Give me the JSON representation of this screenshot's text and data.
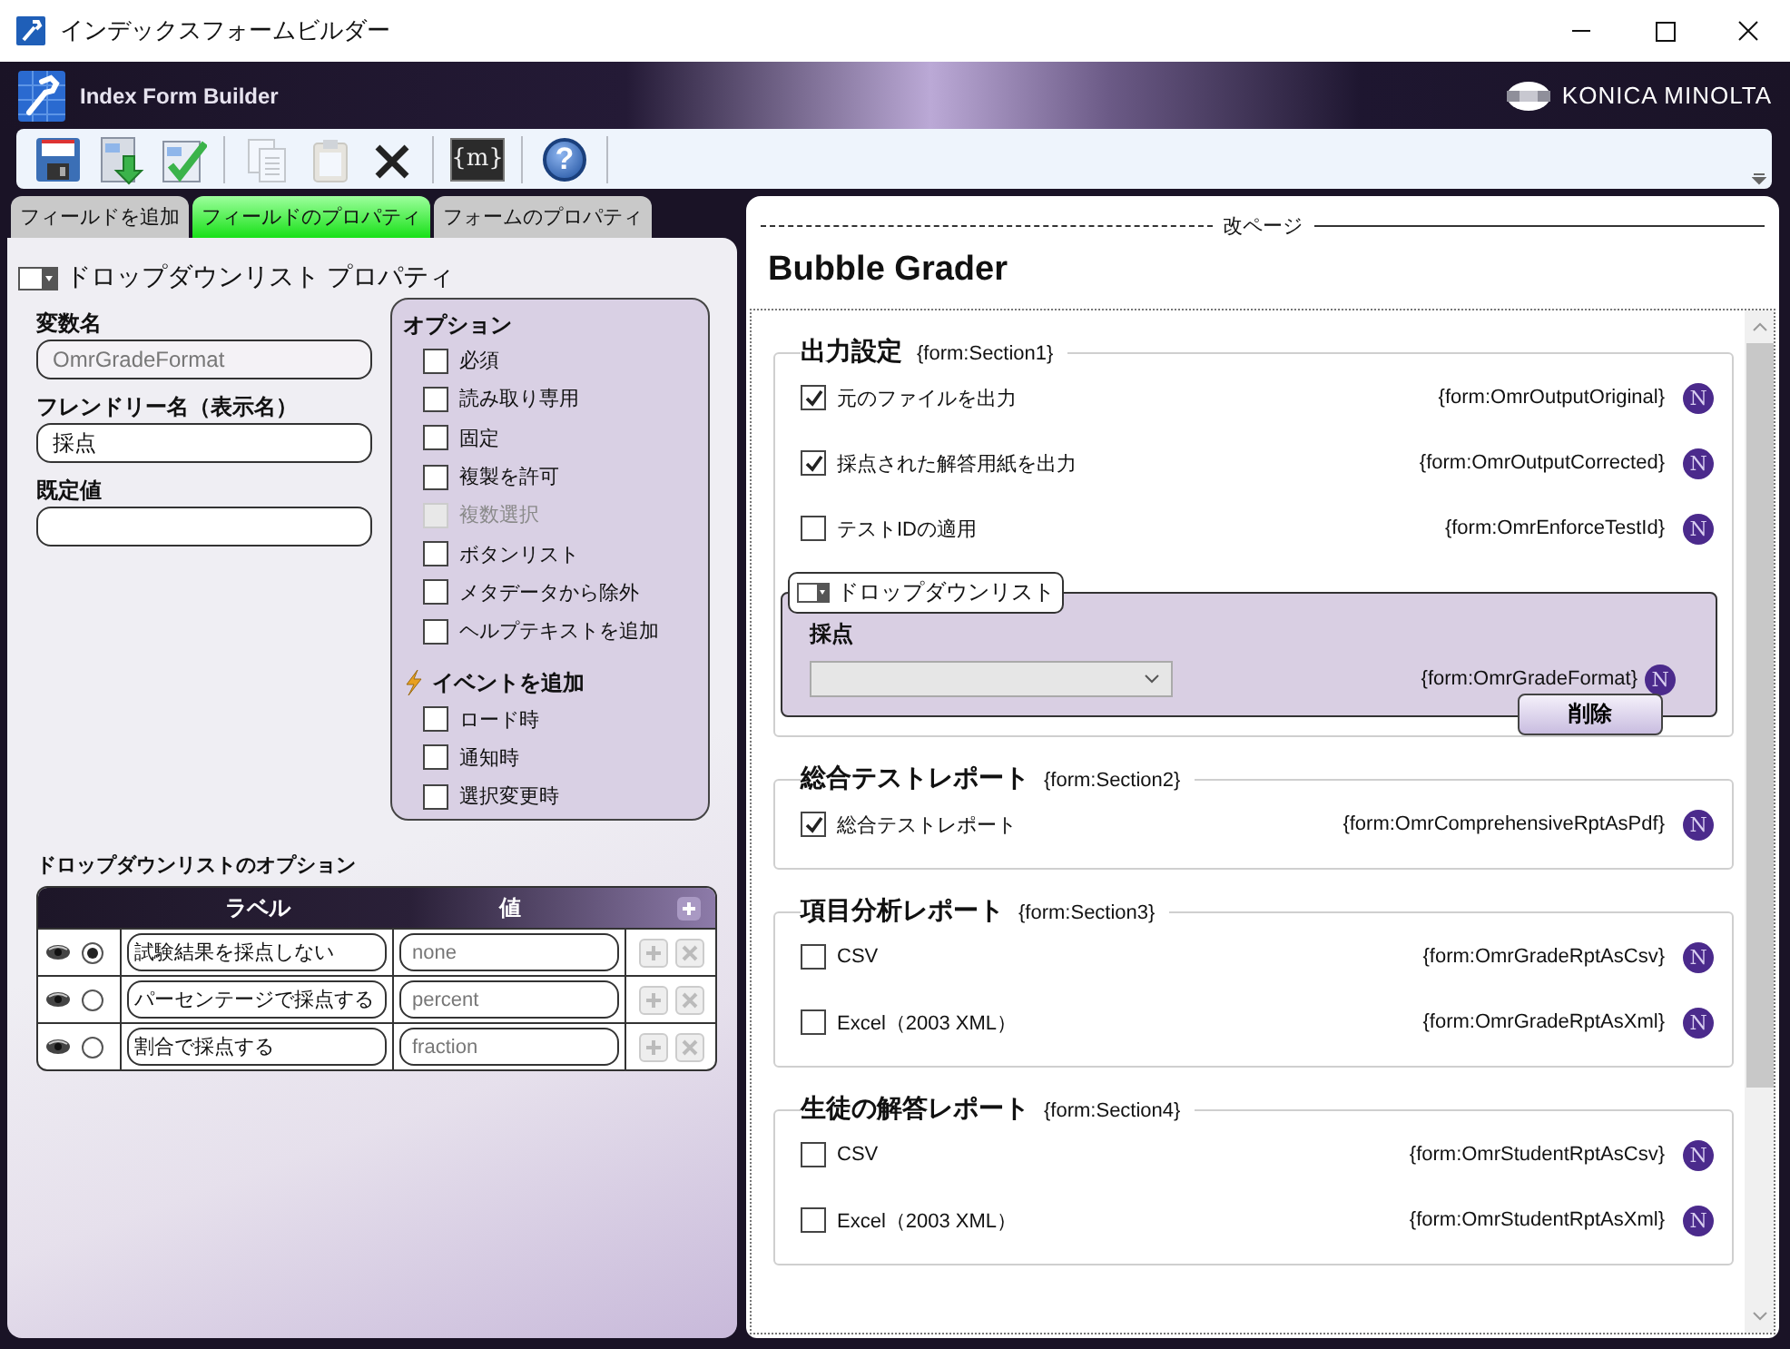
{
  "window": {
    "title": "インデックスフォームビルダー"
  },
  "header": {
    "app_name": "Index Form Builder",
    "brand": "KONICA MINOLTA"
  },
  "toolbar": [
    {
      "kind": "save",
      "disabled": false
    },
    {
      "kind": "import",
      "disabled": false
    },
    {
      "kind": "validate",
      "disabled": false
    },
    {
      "kind": "separator"
    },
    {
      "kind": "copy",
      "disabled": true
    },
    {
      "kind": "paste",
      "disabled": true
    },
    {
      "kind": "delete",
      "disabled": false
    },
    {
      "kind": "separator"
    },
    {
      "kind": "variable",
      "label": "{m}",
      "disabled": false
    },
    {
      "kind": "separator"
    },
    {
      "kind": "help",
      "label": "?",
      "disabled": false
    },
    {
      "kind": "separator"
    }
  ],
  "tabs": [
    {
      "label": "フィールドを追加",
      "selected": false
    },
    {
      "label": "フィールドのプロパティ",
      "selected": true
    },
    {
      "label": "フォームのプロパティ",
      "selected": false
    }
  ],
  "properties": {
    "title": "ドロップダウンリスト プロパティ",
    "fields": [
      {
        "label": "変数名",
        "value": "OmrGradeFormat",
        "disabled": true
      },
      {
        "label": "フレンドリー名（表示名）",
        "value": "採点",
        "disabled": false
      },
      {
        "label": "既定値",
        "disabled": false
      }
    ],
    "options": {
      "title": "オプション",
      "items": [
        {
          "label": "必須",
          "checked": false,
          "disabled": false
        },
        {
          "label": "読み取り専用",
          "checked": false,
          "disabled": false
        },
        {
          "label": "固定",
          "checked": false,
          "disabled": false
        },
        {
          "label": "複製を許可",
          "checked": false,
          "disabled": false
        },
        {
          "label": "複数選択",
          "checked": false,
          "disabled": true
        },
        {
          "label": "ボタンリスト",
          "checked": false,
          "disabled": false
        },
        {
          "label": "メタデータから除外",
          "checked": false,
          "disabled": false
        },
        {
          "label": "ヘルプテキストを追加",
          "checked": false,
          "disabled": false
        }
      ]
    },
    "events": {
      "title": "イベントを追加",
      "items": [
        {
          "label": "ロード時",
          "checked": false
        },
        {
          "label": "通知時",
          "checked": false
        },
        {
          "label": "選択変更時",
          "checked": false
        }
      ]
    }
  },
  "dropdown_options": {
    "title": "ドロップダウンリストのオプション",
    "columns": [
      "ラベル",
      "値"
    ],
    "rows": [
      {
        "label": "試験結果を採点しない",
        "value": "none",
        "selected": true
      },
      {
        "label": "パーセンテージで採点する",
        "value": "percent",
        "selected": false
      },
      {
        "label": "割合で採点する",
        "value": "fraction",
        "selected": false
      }
    ]
  },
  "form": {
    "page_break": "改ページ",
    "title": "Bubble Grader",
    "sections": [
      {
        "title": "出力設定",
        "tag": "{form:Section1}",
        "fields": [
          {
            "kind": "checkbox",
            "label": "元のファイルを出力",
            "checked": true,
            "variable": "{form:OmrOutputOriginal}",
            "badge": "N"
          },
          {
            "kind": "checkbox",
            "label": "採点された解答用紙を出力",
            "checked": true,
            "variable": "{form:OmrOutputCorrected}",
            "badge": "N"
          },
          {
            "kind": "checkbox",
            "label": "テストIDの適用",
            "checked": false,
            "variable": "{form:OmrEnforceTestId}",
            "badge": "N"
          },
          {
            "kind": "dropdown",
            "type_label": "ドロップダウンリスト",
            "label": "採点",
            "variable": "{form:OmrGradeFormat}",
            "badge": "N",
            "delete_label": "削除"
          }
        ]
      },
      {
        "title": "総合テストレポート",
        "tag": "{form:Section2}",
        "fields": [
          {
            "kind": "checkbox",
            "label": "総合テストレポート",
            "checked": true,
            "variable": "{form:OmrComprehensiveRptAsPdf}",
            "badge": "N"
          }
        ]
      },
      {
        "title": "項目分析レポート",
        "tag": "{form:Section3}",
        "fields": [
          {
            "kind": "checkbox",
            "label": "CSV",
            "checked": false,
            "variable": "{form:OmrGradeRptAsCsv}",
            "badge": "N"
          },
          {
            "kind": "checkbox",
            "label": "Excel（2003 XML）",
            "checked": false,
            "variable": "{form:OmrGradeRptAsXml}",
            "badge": "N"
          }
        ]
      },
      {
        "title": "生徒の解答レポート",
        "tag": "{form:Section4}",
        "fields": [
          {
            "kind": "checkbox",
            "label": "CSV",
            "checked": false,
            "variable": "{form:OmrStudentRptAsCsv}",
            "badge": "N"
          },
          {
            "kind": "checkbox",
            "label": "Excel（2003 XML）",
            "checked": false,
            "variable": "{form:OmrStudentRptAsXml}",
            "badge": "N"
          }
        ]
      }
    ]
  }
}
